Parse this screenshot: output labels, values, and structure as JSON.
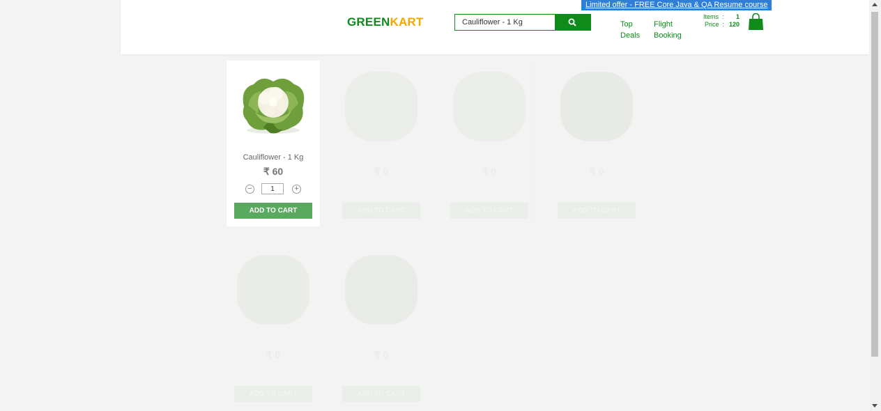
{
  "promo": {
    "text": "Limited offer - FREE Core Java & QA Resume course"
  },
  "logo": {
    "part1": "GREEN",
    "part2": "KART"
  },
  "search": {
    "value": "Cauliflower - 1 Kg",
    "icon": "search-icon"
  },
  "nav": {
    "top_deals": {
      "line1": "Top",
      "line2": "Deals"
    },
    "flight_booking": {
      "line1": "Flight",
      "line2": "Booking"
    }
  },
  "cart": {
    "items_label": "Items",
    "items_sep": ":",
    "items_value": "1",
    "price_label": "Price",
    "price_sep": ":",
    "price_value": "120",
    "icon": "shopping-bag-icon"
  },
  "products": [
    {
      "name": "Cauliflower - 1 Kg",
      "price": "₹ 60",
      "qty": "1",
      "button": "ADD TO CART",
      "image": "cauliflower-image"
    },
    {
      "name": "",
      "price": "₹ 0",
      "qty": "",
      "button": "ADD TO CART",
      "image": "product-image"
    },
    {
      "name": "",
      "price": "₹ 0",
      "qty": "",
      "button": "ADD TO CART",
      "image": "product-image"
    },
    {
      "name": "",
      "price": "₹ 0",
      "qty": "",
      "button": "ADD TO CART",
      "image": "product-image"
    },
    {
      "name": "",
      "price": "₹ 0",
      "qty": "",
      "button": "ADD TO CART",
      "image": "product-image"
    },
    {
      "name": "",
      "price": "₹ 0",
      "qty": "",
      "button": "ADD TO CART",
      "image": "product-image"
    }
  ],
  "stepper": {
    "decrement": "−",
    "increment": "+"
  },
  "colors": {
    "brand_green": "#0f8a1b",
    "brand_orange": "#f7a600",
    "promo_blue": "#2f7fd8",
    "button_green": "#5aa95e"
  }
}
